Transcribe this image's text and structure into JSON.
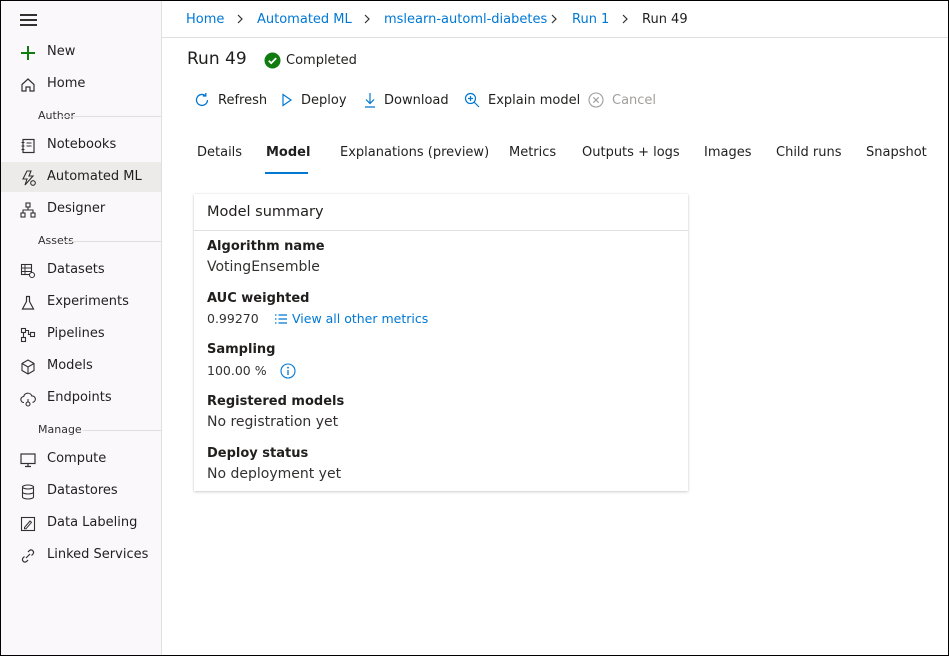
{
  "sidebar": {
    "items_top": [
      {
        "label": "New",
        "icon": "plus-icon"
      },
      {
        "label": "Home",
        "icon": "home-icon"
      }
    ],
    "author_label": "Author",
    "author_items": [
      {
        "label": "Notebooks",
        "icon": "notebook-icon"
      },
      {
        "label": "Automated ML",
        "icon": "automated-ml-icon"
      },
      {
        "label": "Designer",
        "icon": "designer-icon"
      }
    ],
    "assets_label": "Assets",
    "assets_items": [
      {
        "label": "Datasets",
        "icon": "datasets-icon"
      },
      {
        "label": "Experiments",
        "icon": "flask-icon"
      },
      {
        "label": "Pipelines",
        "icon": "pipelines-icon"
      },
      {
        "label": "Models",
        "icon": "cube-icon"
      },
      {
        "label": "Endpoints",
        "icon": "cloud-endpoint-icon"
      }
    ],
    "manage_label": "Manage",
    "manage_items": [
      {
        "label": "Compute",
        "icon": "monitor-icon"
      },
      {
        "label": "Datastores",
        "icon": "database-icon"
      },
      {
        "label": "Data Labeling",
        "icon": "labeling-icon"
      },
      {
        "label": "Linked Services",
        "icon": "link-icon"
      }
    ],
    "active_item": "Automated ML"
  },
  "breadcrumb": [
    "Home",
    "Automated ML",
    "mslearn-automl-diabetes",
    "Run 1",
    "Run 49"
  ],
  "header": {
    "title": "Run 49",
    "status": "Completed",
    "status_color": "#107c10"
  },
  "commands": [
    {
      "label": "Refresh",
      "icon": "refresh-icon",
      "enabled": true
    },
    {
      "label": "Deploy",
      "icon": "play-icon",
      "enabled": true
    },
    {
      "label": "Download",
      "icon": "download-icon",
      "enabled": true
    },
    {
      "label": "Explain model",
      "icon": "explain-icon",
      "enabled": true
    },
    {
      "label": "Cancel",
      "icon": "cancel-icon",
      "enabled": false
    }
  ],
  "tabs": [
    "Details",
    "Model",
    "Explanations (preview)",
    "Metrics",
    "Outputs + logs",
    "Images",
    "Child runs",
    "Snapshot"
  ],
  "active_tab": "Model",
  "model_summary": {
    "title": "Model summary",
    "algorithm_label": "Algorithm name",
    "algorithm_value": "VotingEnsemble",
    "auc_label": "AUC weighted",
    "auc_value": "0.99270",
    "metrics_link": "View all other metrics",
    "sampling_label": "Sampling",
    "sampling_value": "100.00 %",
    "registered_label": "Registered models",
    "registered_value": "No registration yet",
    "deploy_label": "Deploy status",
    "deploy_value": "No deployment yet"
  },
  "colors": {
    "accent": "#0078d4",
    "success": "#107c10",
    "new_plus": "#107c10"
  }
}
